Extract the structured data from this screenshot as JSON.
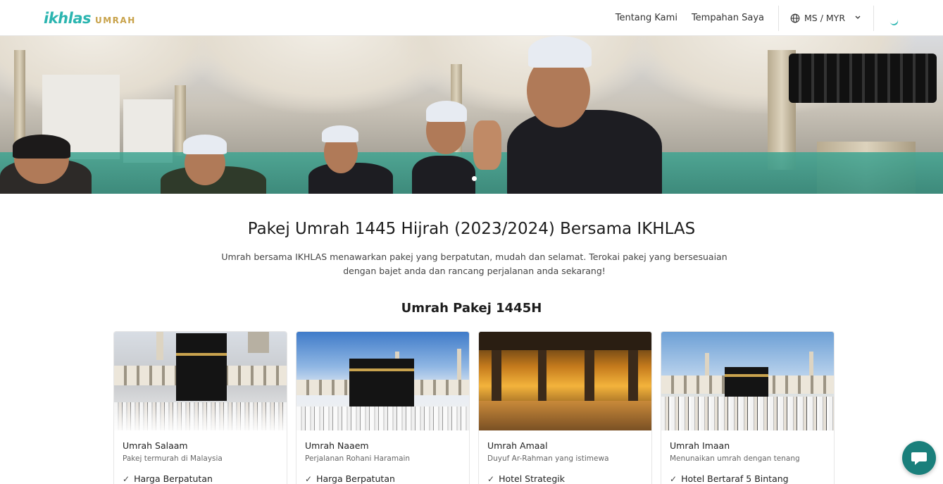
{
  "header": {
    "logo_main": "ikhlas",
    "logo_sub": "UMRAH",
    "nav": [
      "Tentang Kami",
      "Tempahan Saya"
    ],
    "language": "MS / MYR",
    "icons": [
      "globe-icon",
      "chevron-down-icon",
      "loading-spinner"
    ]
  },
  "hero": {
    "slide_count": 1,
    "active_slide": 1
  },
  "intro": {
    "title": "Pakej Umrah 1445 Hijrah (2023/2024) Bersama IKHLAS",
    "subtitle": "Umrah bersama IKHLAS menawarkan pakej yang berpatutan, mudah dan selamat. Terokai pakej yang bersesuaian dengan bajet anda dan rancang perjalanan anda sekarang!"
  },
  "section": {
    "title": "Umrah Pakej 1445H"
  },
  "packages": [
    {
      "name": "Umrah Salaam",
      "desc": "Pakej termurah di Malaysia",
      "feature": "Harga Berpatutan"
    },
    {
      "name": "Umrah Naaem",
      "desc": "Perjalanan Rohani Haramain",
      "feature": "Harga Berpatutan"
    },
    {
      "name": "Umrah Amaal",
      "desc": "Duyuf Ar-Rahman yang istimewa",
      "feature": "Hotel Strategik"
    },
    {
      "name": "Umrah Imaan",
      "desc": "Menunaikan umrah dengan tenang",
      "feature": "Hotel Bertaraf 5 Bintang"
    }
  ],
  "colors": {
    "brand_teal": "#2bb5b0",
    "brand_gold": "#c8a24a",
    "chat_button": "#1a7f7b"
  },
  "chat": {
    "icon": "chat-bubble-icon"
  }
}
